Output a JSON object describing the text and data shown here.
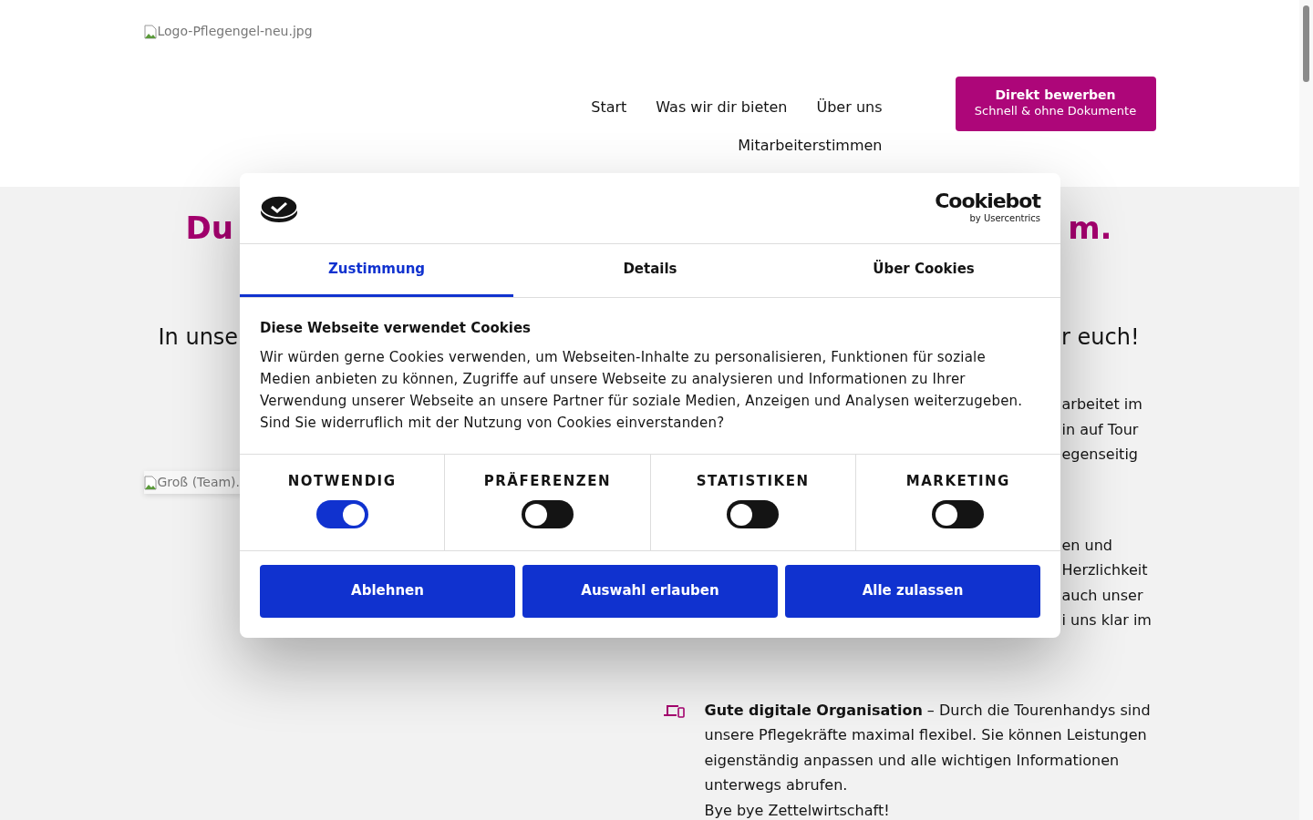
{
  "header": {
    "logo_alt": "Logo-Pflegengel-neu.jpg",
    "nav": [
      {
        "label": "Start"
      },
      {
        "label": "Was wir dir bieten"
      },
      {
        "label": "Über uns"
      },
      {
        "label": "Mitarbeiterstimmen"
      }
    ],
    "apply_button": {
      "title": "Direkt bewerben",
      "subtitle": "Schnell & ohne Dokumente"
    }
  },
  "hero": {
    "heading_parts": [
      "Du",
      "m."
    ],
    "intro_parts": [
      "In unse",
      "r euch!"
    ]
  },
  "team_image": {
    "alt": "Groß (Team)."
  },
  "feature_fragments": [
    [
      "arbeitet im",
      "in auf Tour",
      "egenseitig"
    ],
    [
      "en und",
      "Herzlichkeit",
      "auch unser",
      "i uns klar im"
    ]
  ],
  "feature": {
    "text": "**Gute digitale Organisation** – Durch die Tourenhandys sind unsere Pflegekräfte maximal flexibel. Sie können Leistungen eigenständig anpassen und alle wichtigen Informationen unterwegs abrufen.",
    "note": "Bye bye Zettelwirtschaft!"
  },
  "cookie_dialog": {
    "brand": {
      "wordmark": "Cookiebot",
      "tagline": "by Usercentrics"
    },
    "tabs": [
      {
        "label": "Zustimmung",
        "selected": true
      },
      {
        "label": "Details",
        "selected": false
      },
      {
        "label": "Über Cookies",
        "selected": false
      }
    ],
    "title": "Diese Webseite verwendet Cookies",
    "text": "Wir würden gerne Cookies verwenden, um Webseiten-Inhalte zu personalisieren, Funktionen für soziale Medien anbieten zu können, Zugriffe auf unsere Webseite zu analysieren und Informationen zu Ihrer Verwendung unserer Webseite an unsere Partner für soziale Medien, Anzeigen und Analysen weiterzugeben. Sind Sie widerruflich mit der Nutzung von Cookies einverstanden?",
    "categories": [
      {
        "label": "NOTWENDIG",
        "on": true
      },
      {
        "label": "PRÄFERENZEN",
        "on": false
      },
      {
        "label": "STATISTIKEN",
        "on": false
      },
      {
        "label": "MARKETING",
        "on": false
      }
    ],
    "buttons": [
      "Ablehnen",
      "Auswahl erlauben",
      "Alle zulassen"
    ]
  }
}
